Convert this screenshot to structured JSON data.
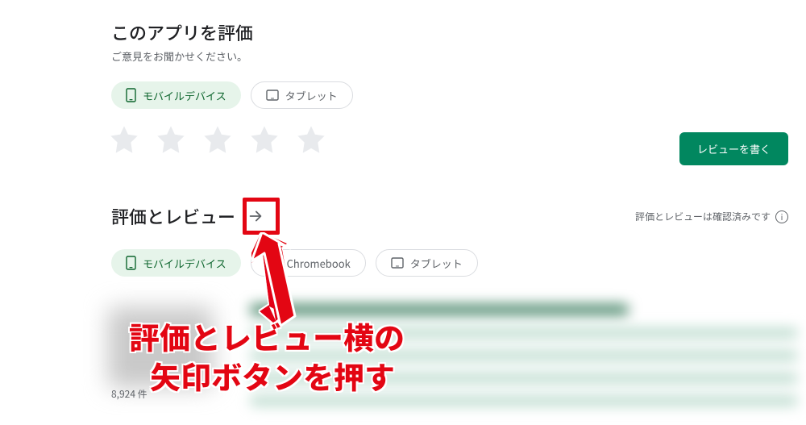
{
  "rate_section": {
    "title": "このアプリを評価",
    "subtitle": "ご意見をお聞かせください。",
    "chips": {
      "mobile": "モバイルデバイス",
      "tablet": "タブレット"
    }
  },
  "write_review_button": "レビューを書く",
  "reviews_section": {
    "title": "評価とレビュー",
    "verified_text": "評価とレビューは確認済みです",
    "chips": {
      "mobile": "モバイルデバイス",
      "chromebook": "Chromebook",
      "tablet": "タブレット"
    },
    "review_count": "8,924 件"
  },
  "annotation": {
    "line1": "評価とレビュー横の",
    "line2": "矢印ボタンを押す"
  },
  "colors": {
    "accent_green": "#01875f",
    "chip_green_bg": "#e6f4ea",
    "chip_green_fg": "#0d652d",
    "star_inactive": "#e8eaed",
    "highlight_red": "#e30613",
    "text_secondary": "#5f6368"
  }
}
